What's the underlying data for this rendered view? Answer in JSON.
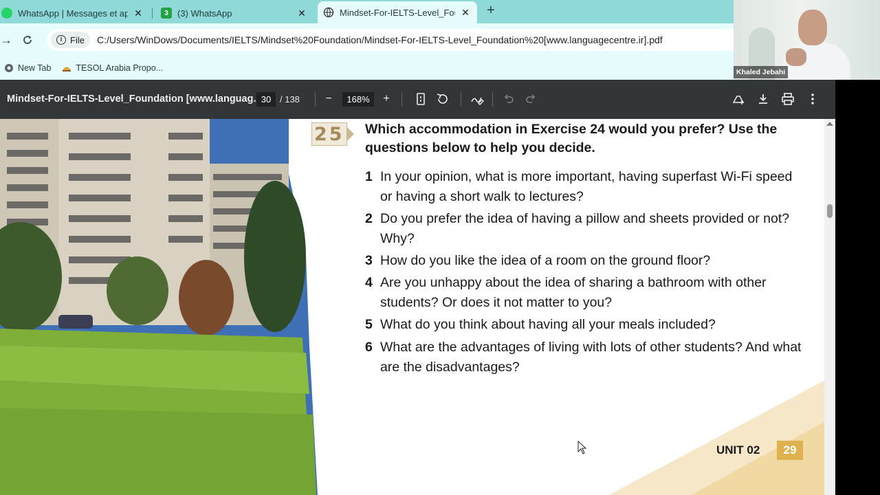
{
  "browser": {
    "tabs": [
      {
        "title": "WhatsApp | Messages et appels",
        "close": "✕"
      },
      {
        "title": "(3) WhatsApp",
        "badge": "3",
        "close": "✕"
      },
      {
        "title": "Mindset-For-IELTS-Level_Foundation",
        "close": "✕"
      }
    ],
    "new_tab": "+",
    "address": {
      "chip": "File",
      "url": "C:/Users/WinDows/Documents/IELTS/Mindset%20Foundation/Mindset-For-IELTS-Level_Foundation%20[www.languagecentre.ir].pdf"
    },
    "bookmarks": [
      "New Tab",
      "TESOL Arabia Propo..."
    ]
  },
  "webcam": {
    "name": "Khaled Jebahi"
  },
  "pdf_toolbar": {
    "title": "Mindset-For-IELTS-Level_Foundation [www.languag...",
    "page": "30",
    "total": "/ 138",
    "zoom": "168%",
    "zoom_out": "−",
    "zoom_in": "+"
  },
  "exercise": {
    "number": "25",
    "heading": "Which accommodation in Exercise 24 would you prefer? Use the questions below to help you decide.",
    "questions": [
      {
        "n": "1",
        "text": "In your opinion, what is more important, having superfast Wi-Fi speed or having a short walk to lectures?"
      },
      {
        "n": "2",
        "text": "Do you prefer the idea of having a pillow and sheets provided or not? Why?"
      },
      {
        "n": "3",
        "text": "How do you like the idea of a room on the ground floor?"
      },
      {
        "n": "4",
        "text": "Are you unhappy about the idea of sharing a bathroom with other students? Or does it not matter to you?"
      },
      {
        "n": "5",
        "text": "What do you think about having all your meals included?"
      },
      {
        "n": "6",
        "text": "What are the advantages of living with lots of other students? And what are the disadvantages?"
      }
    ]
  },
  "footer": {
    "unit": "UNIT 02",
    "page": "29"
  },
  "colors": {
    "chrome": "#8fd9d9",
    "toolbar": "#e6fbfb",
    "pdf_bar": "#323639",
    "accent": "#e0b24f"
  }
}
